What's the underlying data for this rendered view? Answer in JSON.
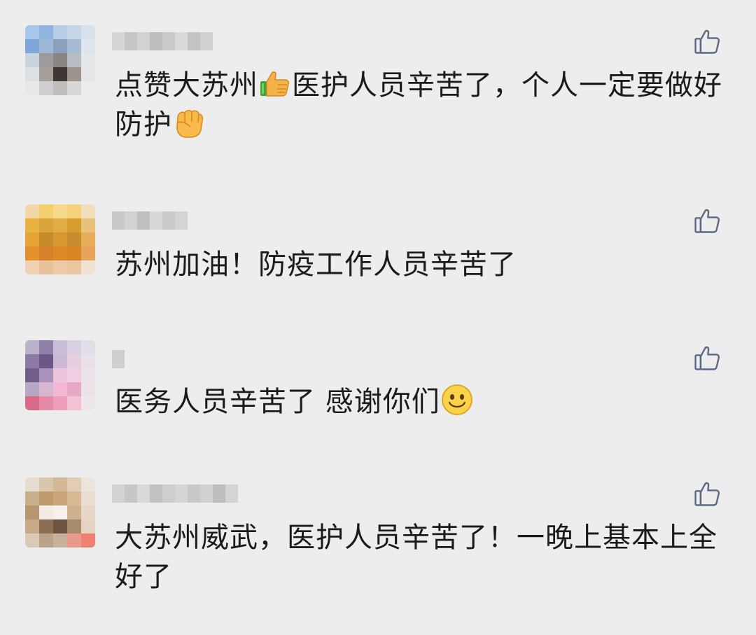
{
  "comments": [
    {
      "text_before": "点赞大苏州",
      "emoji_mid": "thumbs-up-emoji",
      "text_mid": "医护人员辛苦了，个人一定要做好防护",
      "emoji_end": "fist-emoji"
    },
    {
      "text": "苏州加油！防疫工作人员辛苦了"
    },
    {
      "text": "医务人员辛苦了 感谢你们",
      "emoji_end": "smile-emoji"
    },
    {
      "text": "大苏州威武，医护人员辛苦了！一晚上基本上全好了"
    }
  ],
  "icons": {
    "like": "thumbs-up-outline-icon"
  },
  "colors": {
    "background": "#ededed",
    "text": "#1b1b1b",
    "icon_stroke": "#5a6a86"
  }
}
